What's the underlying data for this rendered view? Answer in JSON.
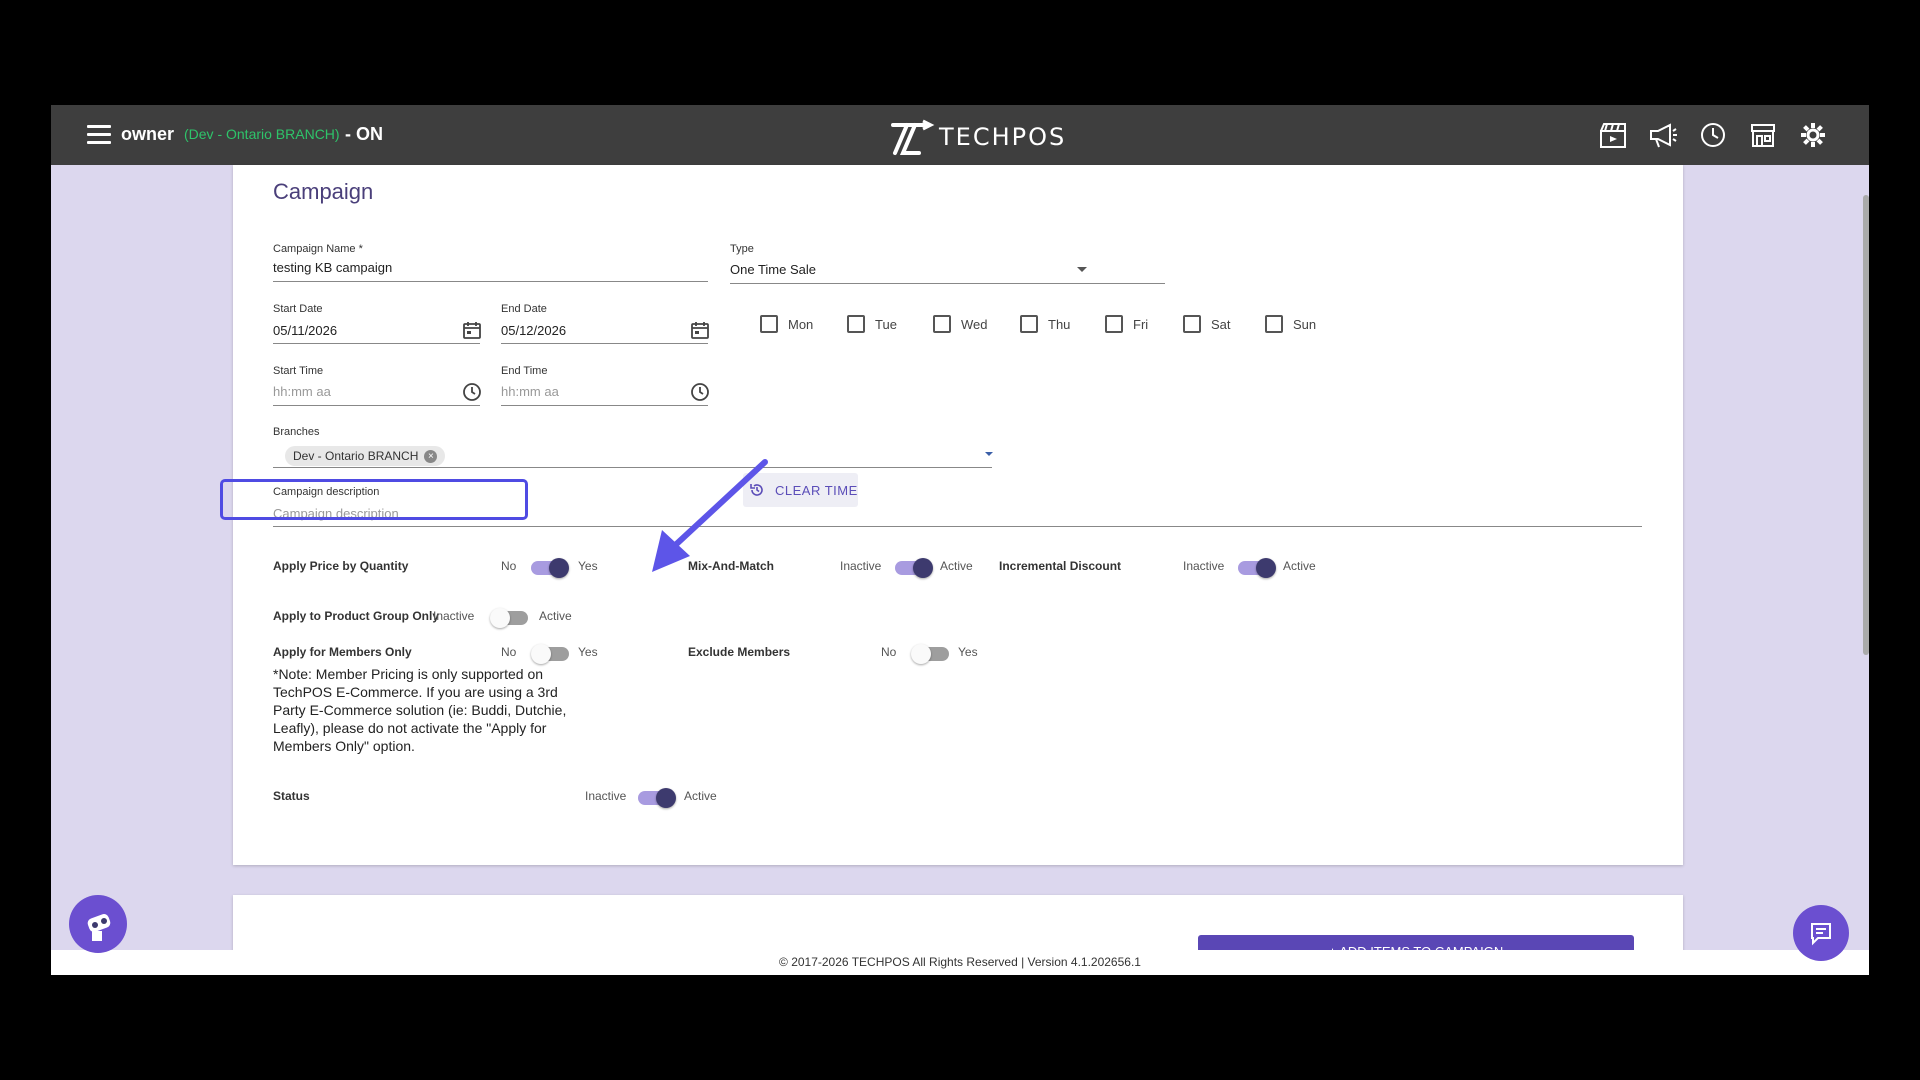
{
  "topbar": {
    "user": "owner",
    "branch": "(Dev - Ontario BRANCH)",
    "status": "- ON",
    "logo_text": "TECHPOS"
  },
  "card": {
    "title": "Campaign",
    "campaign_name_label": "Campaign Name *",
    "campaign_name_value": "testing KB campaign",
    "type_label": "Type",
    "type_value": "One Time Sale",
    "start_date_label": "Start Date",
    "start_date_value": "05/11/2026",
    "end_date_label": "End Date",
    "end_date_value": "05/12/2026",
    "start_time_label": "Start Time",
    "start_time_placeholder": "hh:mm aa",
    "end_time_label": "End Time",
    "end_time_placeholder": "hh:mm aa",
    "days": [
      "Mon",
      "Tue",
      "Wed",
      "Thu",
      "Fri",
      "Sat",
      "Sun"
    ],
    "clear_time": "CLEAR TIME",
    "branches_label": "Branches",
    "branch_chip": "Dev - Ontario BRANCH",
    "description_label": "Campaign description",
    "description_placeholder": "Campaign description",
    "toggles": {
      "price_by_quantity": {
        "label": "Apply Price by Quantity",
        "off": "No",
        "on": "Yes",
        "state": true
      },
      "mix_and_match": {
        "label": "Mix-And-Match",
        "off": "Inactive",
        "on": "Active",
        "state": true
      },
      "incremental_discount": {
        "label": "Incremental Discount",
        "off": "Inactive",
        "on": "Active",
        "state": true
      },
      "product_group_only": {
        "label": "Apply to Product Group Only",
        "off": "Inactive",
        "on": "Active",
        "state": false
      },
      "members_only": {
        "label": "Apply for Members Only",
        "off": "No",
        "on": "Yes",
        "state": false
      },
      "exclude_members": {
        "label": "Exclude Members",
        "off": "No",
        "on": "Yes",
        "state": false
      },
      "status": {
        "label": "Status",
        "off": "Inactive",
        "on": "Active",
        "state": true
      }
    },
    "note": "*Note: Member Pricing is only supported on TechPOS E-Commerce. If you are using a 3rd Party E-Commerce solution (ie: Buddi, Dutchie, Leafly), please do not activate the \"Apply for Members Only\" option."
  },
  "second_card": {
    "add_button": "+ ADD ITEMS TO CAMPAIGN"
  },
  "footer": "© 2017-2026 TECHPOS All Rights Reserved | Version 4.1.202656.1",
  "icons": [
    "menu-icon",
    "clapperboard-icon",
    "megaphone-icon",
    "clock-icon",
    "store-icon",
    "gear-icon",
    "calendar-icon",
    "history-icon",
    "robot-icon",
    "chat-icon"
  ],
  "colors": {
    "accent": "#5a47b5",
    "highlight": "#4f4be3",
    "topbar": "#3e3e3e",
    "branch_green": "#2ec46a"
  }
}
